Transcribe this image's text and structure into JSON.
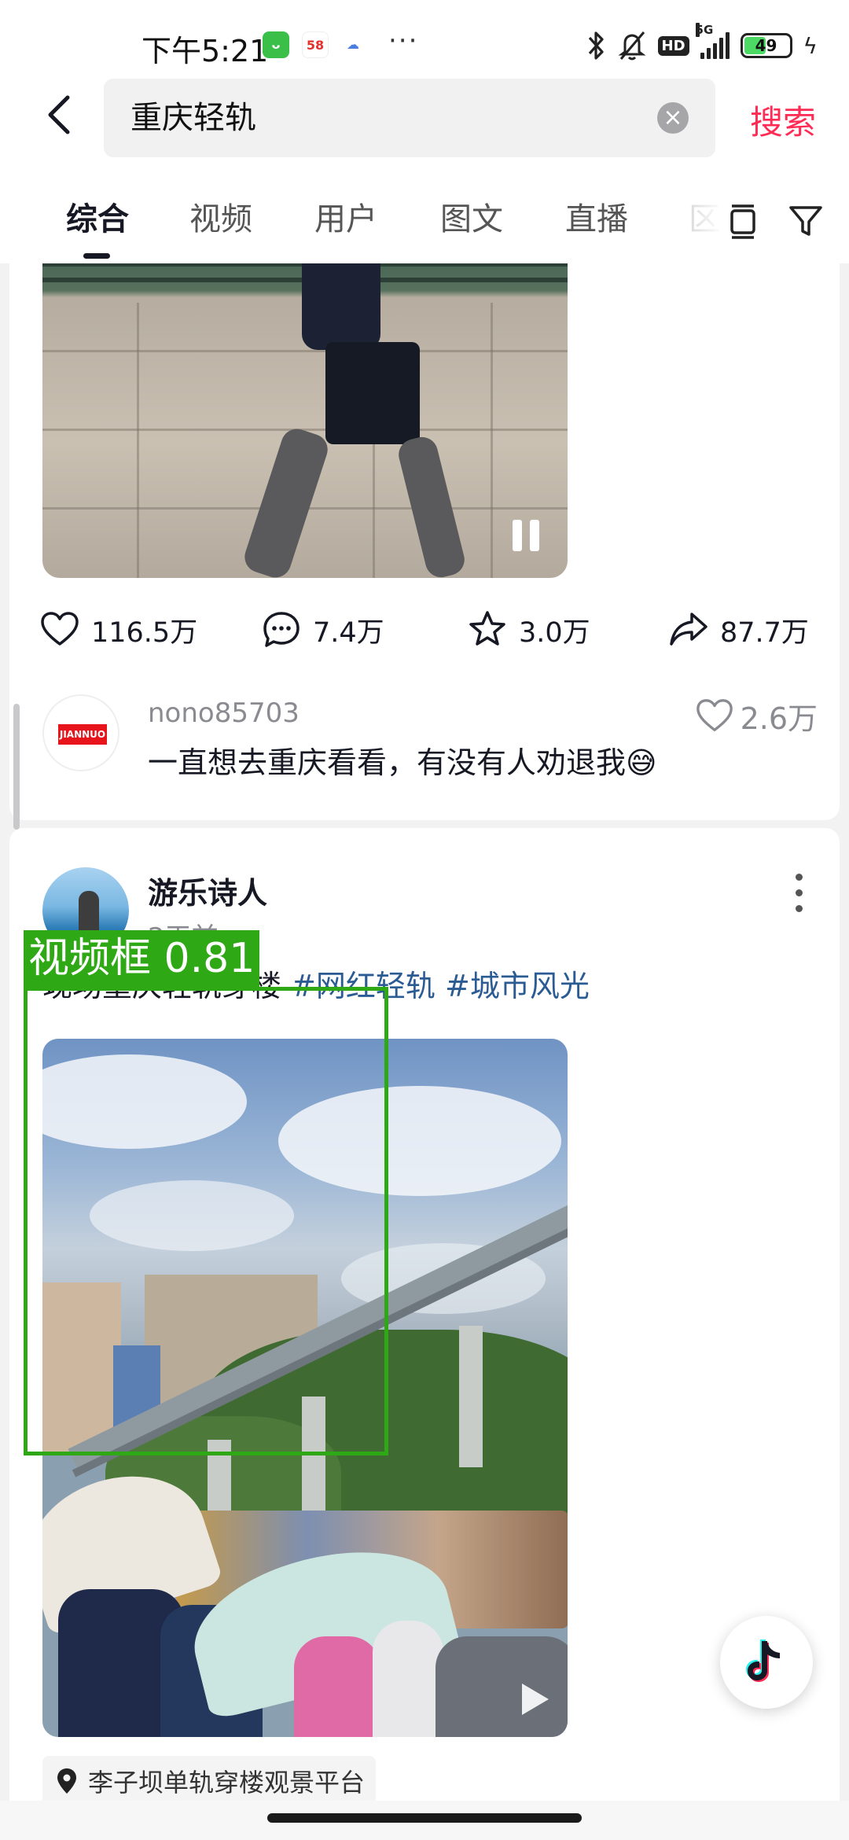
{
  "status_bar": {
    "time": "下午5:21",
    "app_icons": [
      "cat-app-icon",
      "58-app-icon",
      "cloud-app-icon"
    ],
    "more": "···",
    "hd": "HD",
    "network": "5G",
    "battery": "49",
    "battery_level": 0.49
  },
  "search": {
    "query": "重庆轻轨",
    "button_label": "搜索"
  },
  "tabs": {
    "items": [
      "综合",
      "视频",
      "用户",
      "图文",
      "直播"
    ],
    "faded": "区",
    "active_index": 0
  },
  "post1": {
    "stats": {
      "likes": "116.5万",
      "comments": "7.4万",
      "favorites": "3.0万",
      "shares": "87.7万"
    },
    "top_comment": {
      "user": "nono85703",
      "avatar_logo": "JIANNUO",
      "text": "一直想去重庆看看，有没有人劝退我😅",
      "likes": "2.6万"
    }
  },
  "post2": {
    "author": "游乐诗人",
    "time": "2天前",
    "caption": "现场重庆轻轨穿楼 ",
    "tags": [
      "#网红轻轨",
      "#城市风光"
    ],
    "location": "李子坝单轨穿楼观景平台"
  },
  "detection": {
    "label": "视频框 0.81"
  },
  "colors": {
    "accent": "#fe2c55",
    "tag": "#2b5b93",
    "detection": "#2ea814"
  }
}
